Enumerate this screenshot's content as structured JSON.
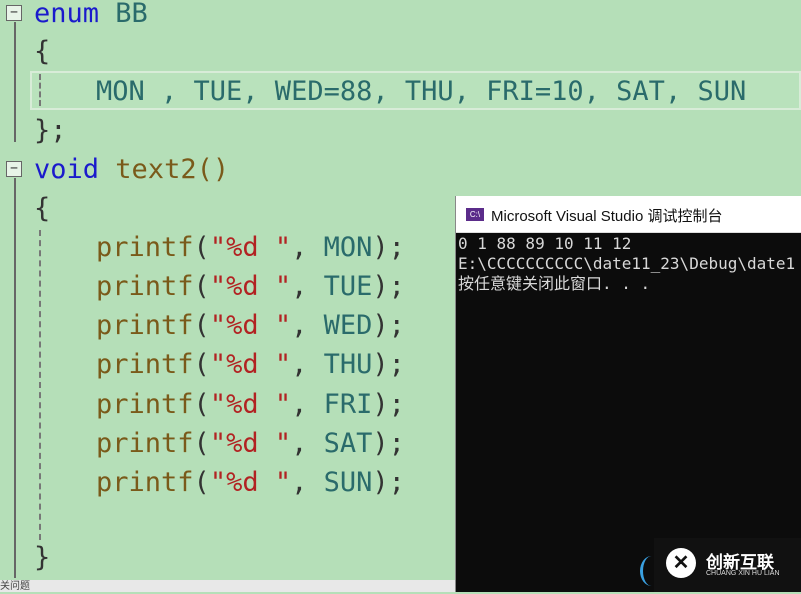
{
  "editor": {
    "collapse_symbol": "−",
    "lines": {
      "enum_kw": "enum",
      "enum_name": "BB",
      "open1": "{",
      "enum_items": "MON , TUE, WED=88, THU, FRI=10, SAT, SUN",
      "close1": "};",
      "void_kw": "void",
      "func_sig": "text2()",
      "open2": "{",
      "printf_fn": "printf",
      "printf_fmt": "\"%d \"",
      "args": [
        "MON",
        "TUE",
        "WED",
        "THU",
        "FRI",
        "SAT",
        "SUN"
      ],
      "close2": "}"
    }
  },
  "status": {
    "bottom_label": "关问题"
  },
  "console": {
    "title": "Microsoft Visual Studio 调试控制台",
    "icon_label": "C:\\",
    "output": [
      "0 1 88 89 10 11 12",
      "E:\\CCCCCCCCCC\\date11_23\\Debug\\date1",
      "按任意键关闭此窗口. . ."
    ]
  },
  "watermark": {
    "cn": "创新互联",
    "en": "CHUANG XIN HU LIAN",
    "symbol": "✕"
  }
}
